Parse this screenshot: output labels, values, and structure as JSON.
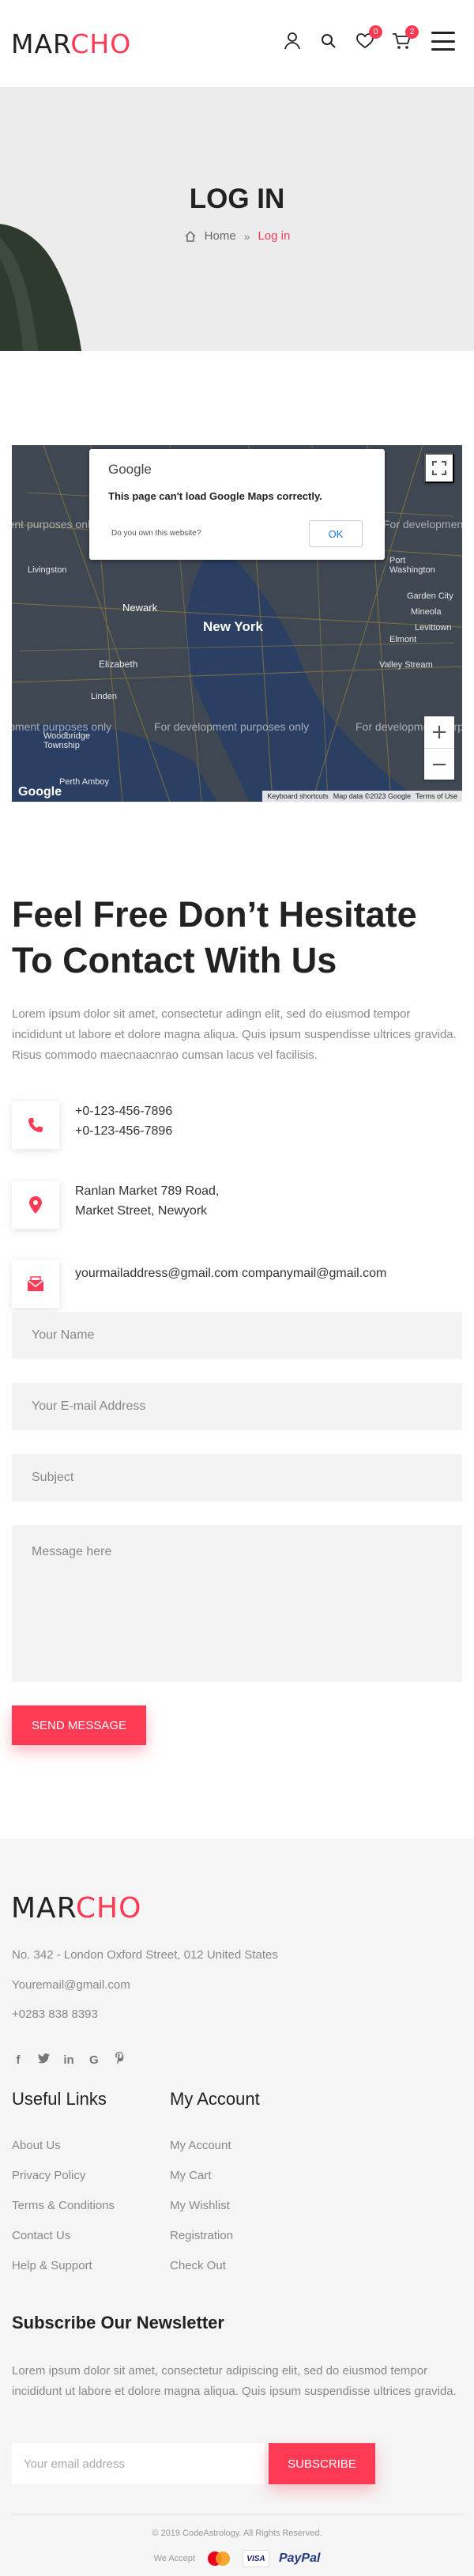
{
  "header": {
    "logo_part1": "MAR",
    "logo_part2": "CHO",
    "wishlist_count": "0",
    "cart_count": "2"
  },
  "breadcrumb": {
    "title": "LOG IN",
    "home": "Home",
    "current": "Log in"
  },
  "map": {
    "google_logo": "Google",
    "error_message": "This page can't load Google Maps correctly.",
    "own_website": "Do you own this website?",
    "ok_label": "OK",
    "dev_text": "For development purposes only",
    "keyboard_shortcuts": "Keyboard shortcuts",
    "map_data": "Map data ©2023 Google",
    "terms": "Terms of Use",
    "watermark": "Google",
    "places": [
      "Livingston",
      "Newark",
      "New York",
      "Elizabeth",
      "Woodbridge Township",
      "Linden",
      "Perth Amboy",
      "Port Washington",
      "Mineola",
      "Elmont",
      "Levittown",
      "Valley Stream",
      "Garden City"
    ]
  },
  "contact": {
    "title": "Feel Free Don’t Hesitate To Contact With Us",
    "text": "Lorem ipsum dolor sit amet, consectetur adingn elit, sed do eiusmod tempor incididunt ut labore et dolore magna aliqua. Quis ipsum suspendisse ultrices gravida. Risus commodo maecnaacnrao cumsan lacus vel facilisis.",
    "phone1": "+0-123-456-7896",
    "phone2": "+0-123-456-7896",
    "address1": "Ranlan Market 789 Road,",
    "address2": "Market Street, Newyork",
    "emails": "yourmailaddress@gmail.com companymail@gmail.com"
  },
  "form": {
    "name_placeholder": "Your Name",
    "email_placeholder": "Your E-mail Address",
    "subject_placeholder": "Subject",
    "message_placeholder": "Message here",
    "send_label": "SEND MESSAGE"
  },
  "footer": {
    "logo_part1": "MAR",
    "logo_part2": "CHO",
    "address": "No. 342 - London Oxford Street, 012 United States",
    "email": "Youremail@gmail.com",
    "phone": "+0283 838 8393",
    "useful_links_title": "Useful Links",
    "useful_links": [
      "About Us",
      "Privacy Policy",
      "Terms & Conditions",
      "Contact Us",
      "Help & Support"
    ],
    "account_title": "My Account",
    "account_links": [
      "My Account",
      "My Cart",
      "My Wishlist",
      "Registration",
      "Check Out"
    ],
    "newsletter_title": "Subscribe Our Newsletter",
    "newsletter_text": "Lorem ipsum dolor sit amet, consectetur adipiscing elit, sed do eiusmod tempor incididunt ut labore et dolore magna aliqua. Quis ipsum suspendisse ultrices gravida.",
    "newsletter_placeholder": "Your email address",
    "subscribe_label": "SUBSCRIBE",
    "copyright": "© 2019 CodeAstrology. All Rights Reserved.",
    "we_accept": "We Accept",
    "visa": "VISA",
    "paypal": "PayPal"
  },
  "colors": {
    "accent": "#ff3a55",
    "text": "#222222",
    "muted": "#888888"
  }
}
